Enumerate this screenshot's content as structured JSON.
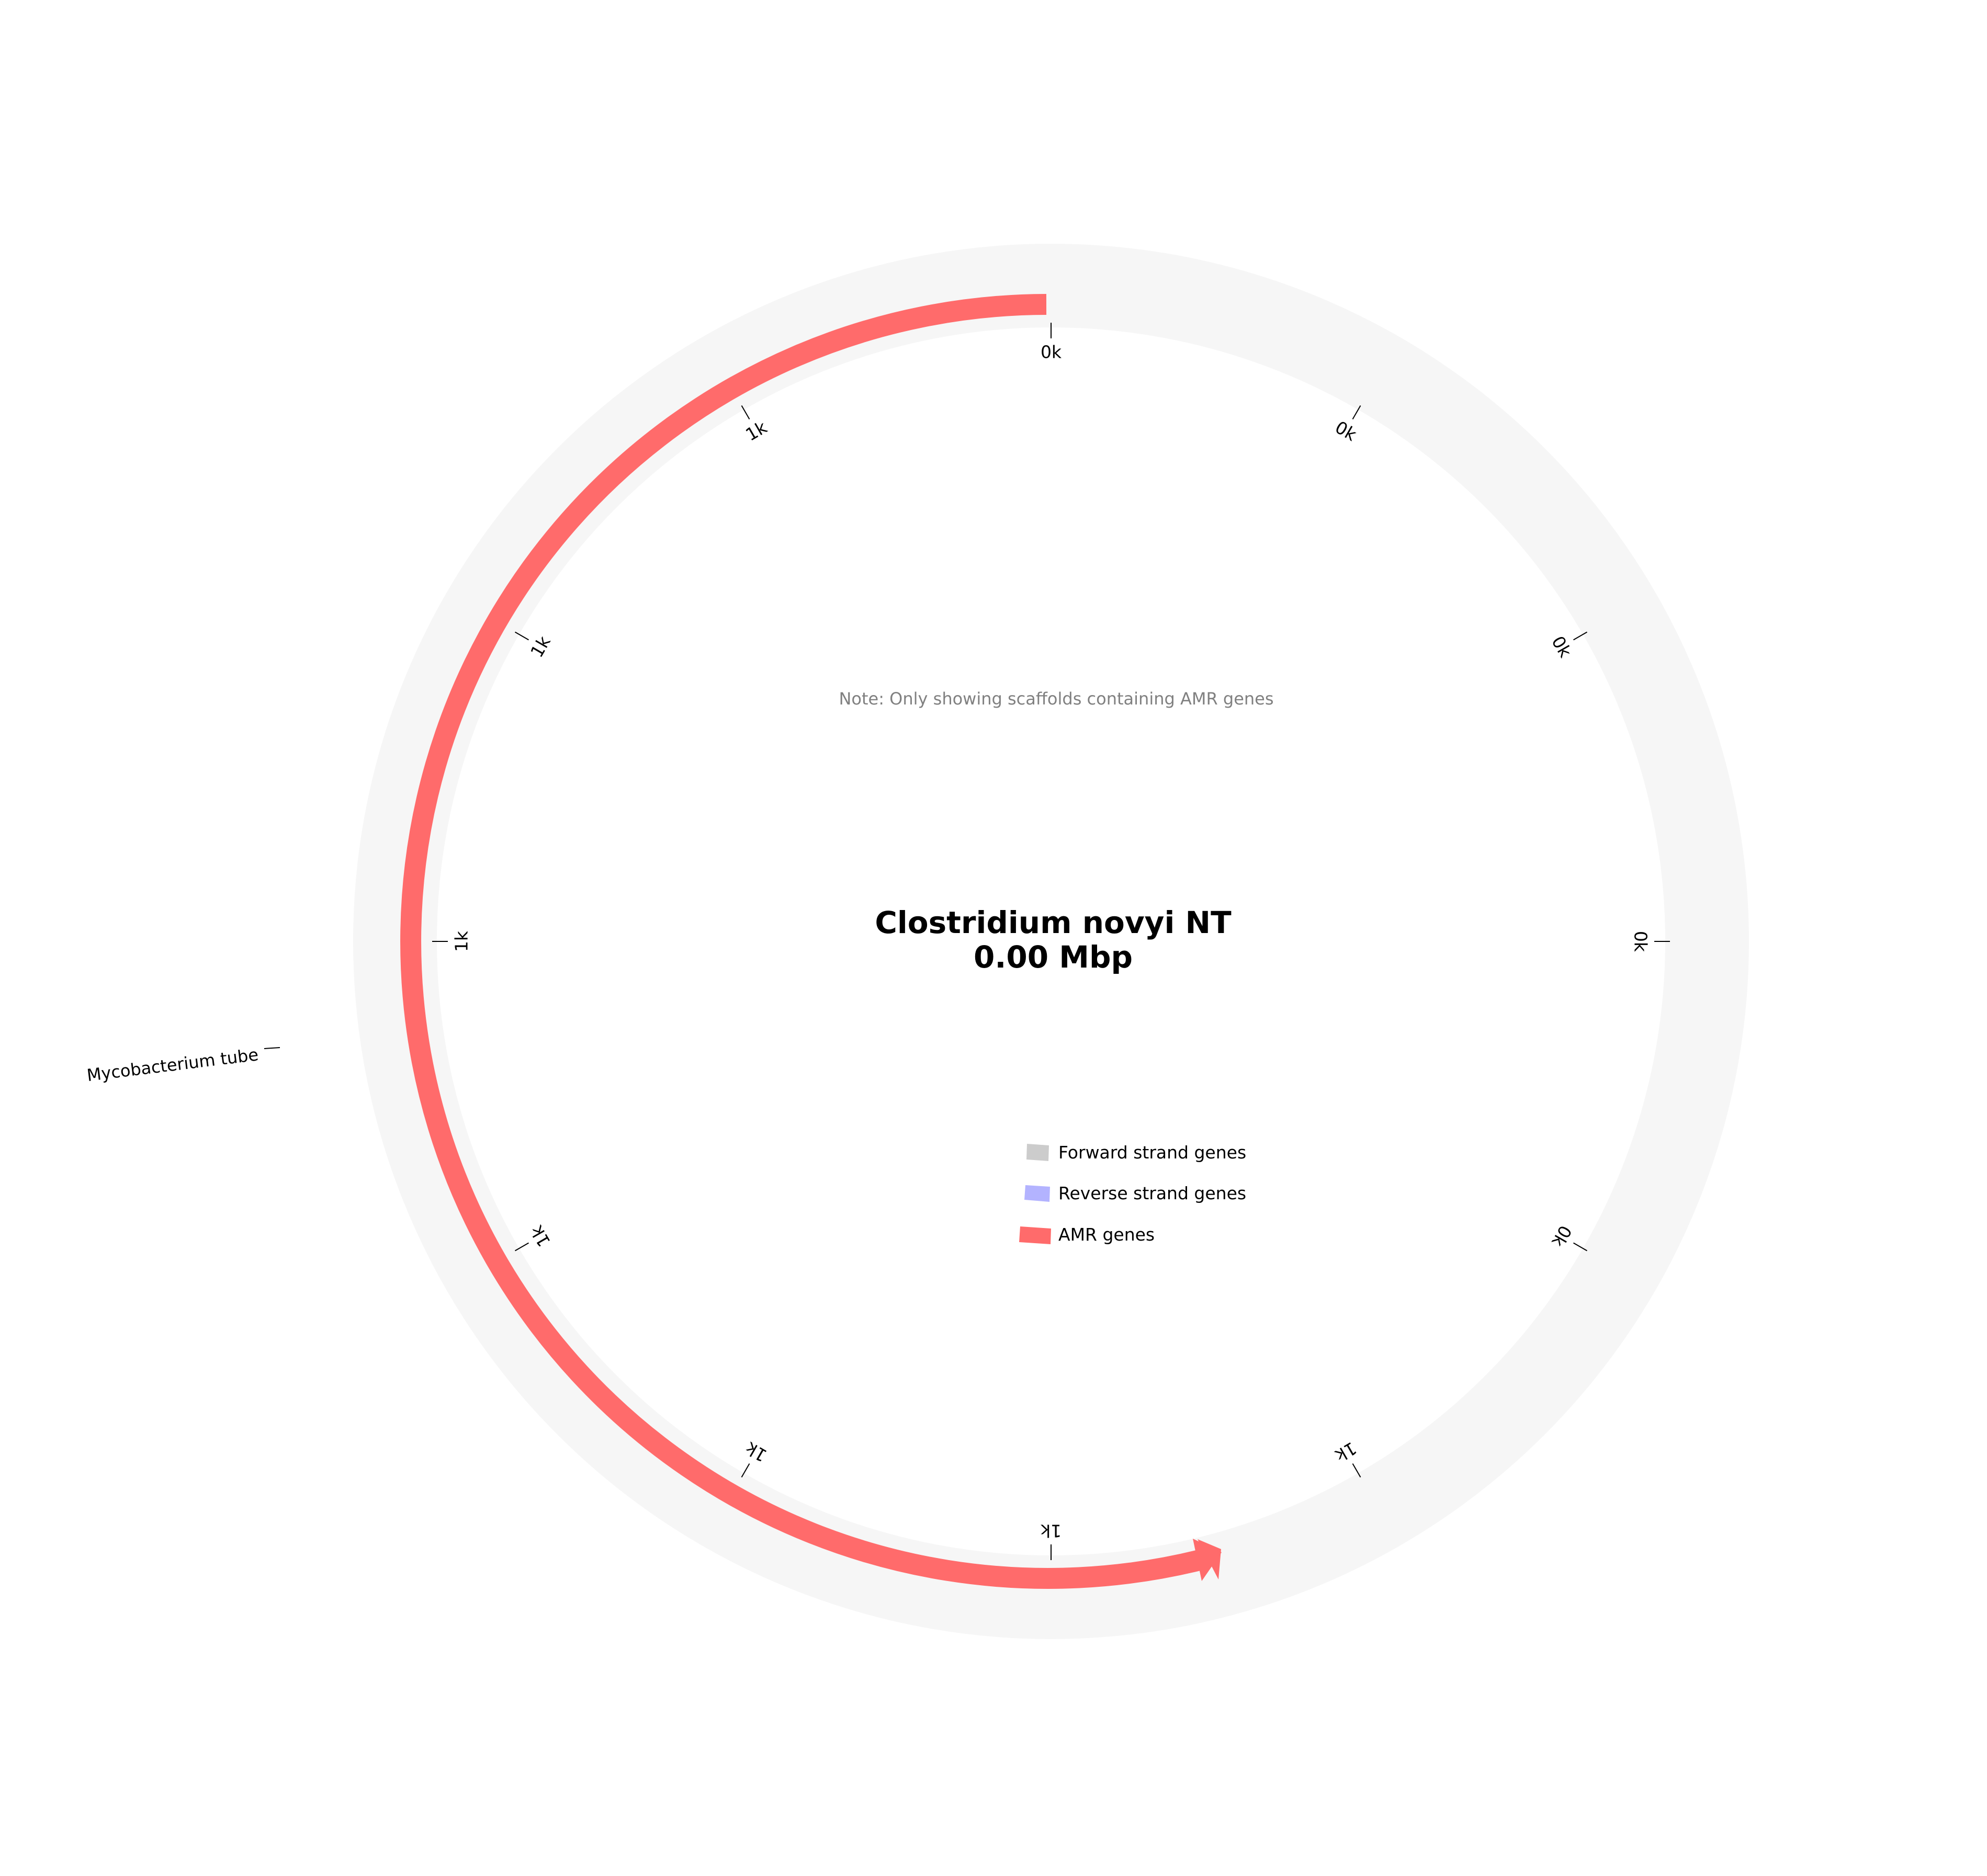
{
  "title": {
    "line1": "Clostridium novyi NT",
    "line2": "0.00 Mbp"
  },
  "note": "Note: Only showing scaffolds containing AMR genes",
  "ticks": [
    "0k",
    "0k",
    "0k",
    "0k",
    "0k",
    "1k",
    "1k",
    "1k",
    "1k",
    "1k",
    "1k",
    "1k"
  ],
  "scaffold_label": "Mycobacterium tube",
  "legend": [
    {
      "label": "Forward strand genes",
      "color": "#cccccc"
    },
    {
      "label": "Reverse strand genes",
      "color": "#b3b3ff"
    },
    {
      "label": "AMR genes",
      "color": "#ff6b6b"
    }
  ],
  "colors": {
    "backbone": "#f5f5f5",
    "amr": "#ff6b6b",
    "tick": "#000000"
  }
}
